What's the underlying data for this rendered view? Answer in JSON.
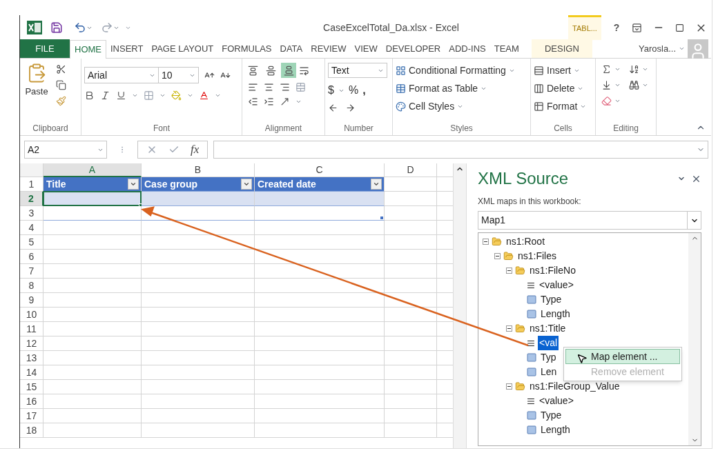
{
  "title_bar": {
    "title": "CaseExcelTotal_Da.xlsx - Excel",
    "context_tab_group": "TABL...",
    "help": "?"
  },
  "tabs": [
    {
      "label": "FILE",
      "kind": "file",
      "selected": false
    },
    {
      "label": "HOME",
      "kind": "tab",
      "selected": true
    },
    {
      "label": "INSERT",
      "kind": "tab",
      "selected": false
    },
    {
      "label": "PAGE LAYOUT",
      "kind": "tab",
      "selected": false
    },
    {
      "label": "FORMULAS",
      "kind": "tab",
      "selected": false
    },
    {
      "label": "DATA",
      "kind": "tab",
      "selected": false
    },
    {
      "label": "REVIEW",
      "kind": "tab",
      "selected": false
    },
    {
      "label": "VIEW",
      "kind": "tab",
      "selected": false
    },
    {
      "label": "DEVELOPER",
      "kind": "tab",
      "selected": false
    },
    {
      "label": "ADD-INS",
      "kind": "tab",
      "selected": false
    },
    {
      "label": "TEAM",
      "kind": "tab",
      "selected": false
    },
    {
      "label": "DESIGN",
      "kind": "context",
      "selected": false
    }
  ],
  "account": {
    "name": "Yarosla..."
  },
  "ribbon": {
    "clipboard": {
      "label": "Clipboard",
      "paste": "Paste"
    },
    "font": {
      "label": "Font",
      "font_name": "Arial",
      "font_size": "10"
    },
    "alignment": {
      "label": "Alignment",
      "vertical": [
        {
          "kind": "top",
          "selected": false
        },
        {
          "kind": "middle",
          "selected": false
        },
        {
          "kind": "bottom",
          "selected": true
        }
      ]
    },
    "number": {
      "label": "Number",
      "format": "Text",
      "currency": "$",
      "percent": "%",
      "comma": ","
    },
    "styles": {
      "label": "Styles",
      "items": [
        "Conditional Formatting",
        "Format as Table",
        "Cell Styles"
      ]
    },
    "cells": {
      "label": "Cells",
      "items": [
        "Insert",
        "Delete",
        "Format"
      ]
    },
    "editing": {
      "label": "Editing"
    }
  },
  "formula_bar": {
    "name_box": "A2",
    "fx": "fx"
  },
  "grid": {
    "columns": [
      {
        "label": "A",
        "selected": true
      },
      {
        "label": "B",
        "selected": false
      },
      {
        "label": "C",
        "selected": false
      },
      {
        "label": "D",
        "selected": false
      }
    ],
    "rows": [
      {
        "label": "1",
        "kind": "header",
        "selected": false,
        "cells": [
          "Title",
          "Case group",
          "Created date"
        ]
      },
      {
        "label": "2",
        "kind": "band",
        "selected": true
      },
      {
        "label": "3",
        "kind": "last",
        "selected": false
      },
      {
        "label": "4",
        "kind": "plain",
        "selected": false
      },
      {
        "label": "5",
        "kind": "plain",
        "selected": false
      },
      {
        "label": "6",
        "kind": "plain",
        "selected": false
      },
      {
        "label": "7",
        "kind": "plain",
        "selected": false
      },
      {
        "label": "8",
        "kind": "plain",
        "selected": false
      },
      {
        "label": "9",
        "kind": "plain",
        "selected": false
      },
      {
        "label": "10",
        "kind": "plain",
        "selected": false
      },
      {
        "label": "11",
        "kind": "plain",
        "selected": false
      },
      {
        "label": "12",
        "kind": "plain",
        "selected": false
      },
      {
        "label": "13",
        "kind": "plain",
        "selected": false
      },
      {
        "label": "14",
        "kind": "plain",
        "selected": false
      },
      {
        "label": "15",
        "kind": "plain",
        "selected": false
      },
      {
        "label": "16",
        "kind": "plain",
        "selected": false
      },
      {
        "label": "17",
        "kind": "plain",
        "selected": false
      },
      {
        "label": "18",
        "kind": "plain",
        "selected": false
      }
    ]
  },
  "xml_source": {
    "title": "XML Source",
    "maps_label": "XML maps in this workbook:",
    "map": "Map1",
    "tree": [
      {
        "label": "ns1:Root",
        "kind": "root",
        "expanded": true,
        "selected": false,
        "children": [
          {
            "label": "ns1:Files",
            "kind": "folder",
            "expanded": true,
            "selected": false,
            "children": [
              {
                "label": "ns1:FileNo",
                "kind": "folder",
                "expanded": true,
                "selected": false,
                "children": [
                  {
                    "label": "<value>",
                    "kind": "text",
                    "selected": false
                  },
                  {
                    "label": "Type",
                    "kind": "attribute",
                    "selected": false
                  },
                  {
                    "label": "Length",
                    "kind": "attribute",
                    "selected": false
                  }
                ]
              },
              {
                "label": "ns1:Title",
                "kind": "folder",
                "expanded": true,
                "selected": false,
                "children": [
                  {
                    "label": "<val",
                    "kind": "text",
                    "selected": true
                  },
                  {
                    "label": "Typ",
                    "kind": "attribute",
                    "selected": false
                  },
                  {
                    "label": "Len",
                    "kind": "attribute",
                    "selected": false
                  }
                ]
              },
              {
                "label": "ns1:FileGroup_Value",
                "kind": "folder",
                "expanded": true,
                "selected": false,
                "children": [
                  {
                    "label": "<value>",
                    "kind": "text",
                    "selected": false
                  },
                  {
                    "label": "Type",
                    "kind": "attribute",
                    "selected": false
                  },
                  {
                    "label": "Length",
                    "kind": "attribute",
                    "selected": false
                  }
                ]
              }
            ]
          }
        ]
      }
    ]
  },
  "context_menu": {
    "items": [
      {
        "label": "Map element ...",
        "selected": true,
        "disabled": false
      },
      {
        "label": "Remove element",
        "selected": false,
        "disabled": true
      }
    ]
  }
}
